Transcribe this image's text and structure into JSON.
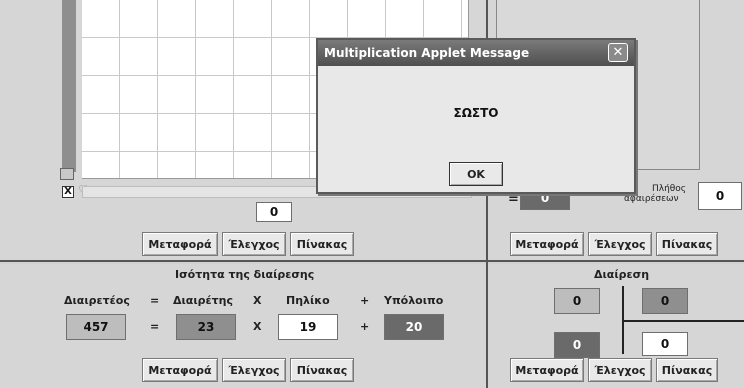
{
  "top_left": {
    "counter_value": "0",
    "buttons": {
      "transfer": "Μεταφορά",
      "check": "Έλεγχος",
      "board": "Πίνακας"
    },
    "corner_mark": "X"
  },
  "top_right": {
    "left_box_value": "0",
    "equals": "=",
    "count_label_line1": "Πλήθος",
    "count_label_line2": "αφαιρέσεων",
    "count_value": "0",
    "buttons": {
      "transfer": "Μεταφορά",
      "check": "Έλεγχος",
      "board": "Πίνακας"
    }
  },
  "equality": {
    "title": "Ισότητα της διαίρεσης",
    "headers": {
      "dividend": "Διαιρετέος",
      "eq": "=",
      "divisor": "Διαιρέτης",
      "times": "X",
      "quotient": "Πηλίκο",
      "plus": "+",
      "remainder": "Υπόλοιπο"
    },
    "values": {
      "dividend": "457",
      "eq": "=",
      "divisor": "23",
      "times": "X",
      "quotient": "19",
      "plus": "+",
      "remainder": "20"
    },
    "buttons": {
      "transfer": "Μεταφορά",
      "check": "Έλεγχος",
      "board": "Πίνακας"
    }
  },
  "division": {
    "title": "Διαίρεση",
    "dividend_value": "0",
    "divisor_value": "0",
    "remainder_value": "0",
    "quotient_value": "0",
    "buttons": {
      "transfer": "Μεταφορά",
      "check": "Έλεγχος",
      "board": "Πίνακας"
    }
  },
  "dialog": {
    "title": "Multiplication Applet Message",
    "message": "ΣΩΣΤΟ",
    "ok_label": "OK",
    "close_glyph": "✕"
  },
  "colors": {
    "box_dark": "#6a6a6a",
    "box_mid": "#8f8f8f",
    "box_light": "#bdbdbd",
    "box_white": "#ffffff"
  }
}
